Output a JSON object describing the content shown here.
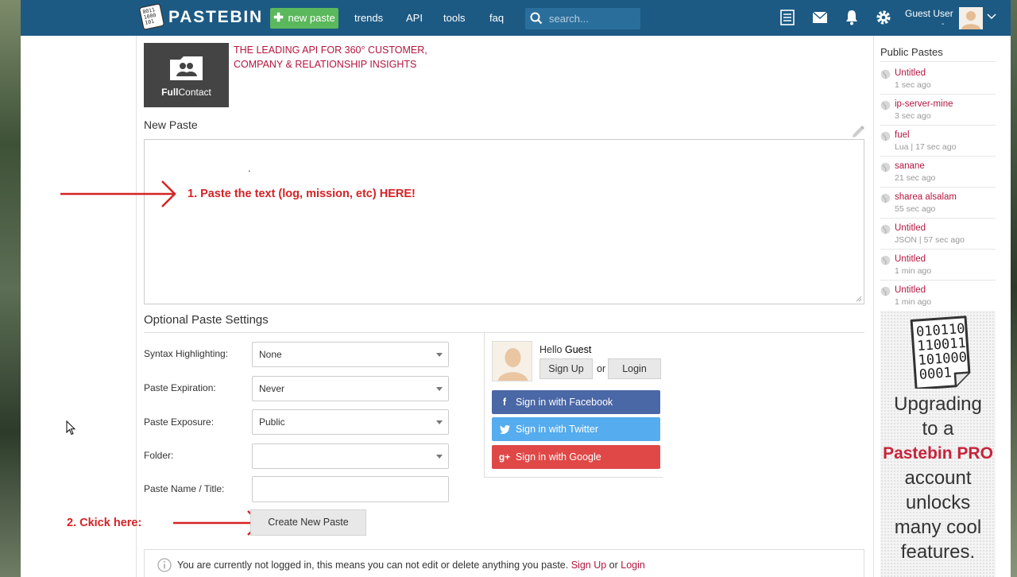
{
  "header": {
    "logo_text": "PASTEBIN",
    "new_paste_label": "new paste",
    "nav": [
      "trends",
      "API",
      "tools",
      "faq"
    ],
    "search_placeholder": "search...",
    "user_name": "Guest User",
    "user_sub": "-"
  },
  "ad": {
    "brand_bold": "Full",
    "brand_rest": "Contact",
    "line1": "THE LEADING API FOR 360° CUSTOMER,",
    "line2": "COMPANY & RELATIONSHIP INSIGHTS"
  },
  "editor": {
    "title": "New Paste",
    "content_dot": "."
  },
  "annotations": {
    "step1": "1.  Paste the text (log, mission, etc) HERE!",
    "step2": "2. Ckick here:"
  },
  "settings": {
    "title": "Optional Paste Settings",
    "syntax_label": "Syntax Highlighting:",
    "syntax_value": "None",
    "expiration_label": "Paste Expiration:",
    "expiration_value": "Never",
    "exposure_label": "Paste Exposure:",
    "exposure_value": "Public",
    "folder_label": "Folder:",
    "folder_value": "",
    "name_label": "Paste Name / Title:",
    "name_value": "",
    "create_button": "Create New Paste"
  },
  "login": {
    "hello_prefix": "Hello ",
    "hello_name": "Guest",
    "signup": "Sign Up",
    "or": "or",
    "login": "Login",
    "facebook": "Sign in with Facebook",
    "twitter": "Sign in with Twitter",
    "google": "Sign in with Google"
  },
  "notice": {
    "text": "You are currently not logged in, this means you can not edit or delete anything you paste.",
    "signup": "Sign Up",
    "or": "or",
    "login": "Login"
  },
  "sidebar": {
    "title": "Public Pastes",
    "items": [
      {
        "title": "Untitled",
        "meta": "1 sec ago"
      },
      {
        "title": "ip-server-mine",
        "meta": "3 sec ago"
      },
      {
        "title": "fuel",
        "meta": "Lua | 17 sec ago"
      },
      {
        "title": "sanane",
        "meta": "21 sec ago"
      },
      {
        "title": "sharea alsalam",
        "meta": "55 sec ago"
      },
      {
        "title": "Untitled",
        "meta": "JSON | 57 sec ago"
      },
      {
        "title": "Untitled",
        "meta": "1 min ago"
      },
      {
        "title": "Untitled",
        "meta": "1 min ago"
      }
    ]
  },
  "pro_ad": {
    "binary": [
      "010110",
      "110011",
      "101000",
      "0001"
    ],
    "line1": "Upgrading",
    "line2": "to a",
    "highlight": "Pastebin PRO",
    "line3": "account",
    "line4": "unlocks",
    "line5": "many cool",
    "line6": "features."
  },
  "colors": {
    "header": "#1c5a84",
    "accent": "#b3163f",
    "annotation": "#d52225",
    "new_paste_button": "#5bb85c",
    "facebook": "#4a67a6",
    "twitter": "#55acee",
    "google": "#e04848"
  }
}
